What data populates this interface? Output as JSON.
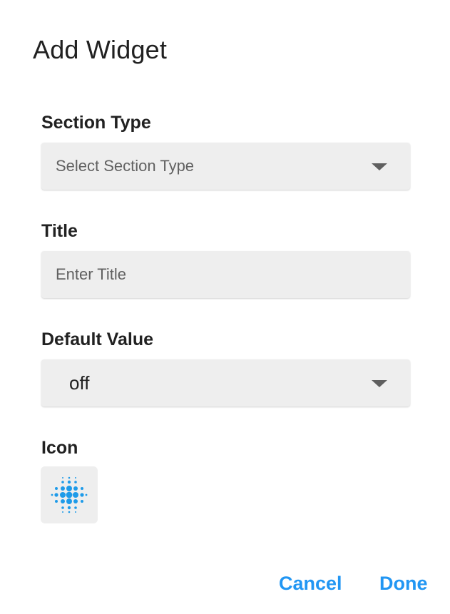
{
  "dialog": {
    "title": "Add Widget"
  },
  "fields": {
    "section_type": {
      "label": "Section Type",
      "placeholder": "Select Section Type"
    },
    "title": {
      "label": "Title",
      "placeholder": "Enter Title"
    },
    "default_value": {
      "label": "Default Value",
      "value": "off"
    },
    "icon": {
      "label": "Icon",
      "icon_name": "dotted-radial-icon"
    }
  },
  "actions": {
    "cancel_label": "Cancel",
    "done_label": "Done"
  },
  "colors": {
    "accent": "#2196f3",
    "field_background": "#eeeeee",
    "text_primary": "#212121",
    "text_placeholder": "#616161"
  }
}
